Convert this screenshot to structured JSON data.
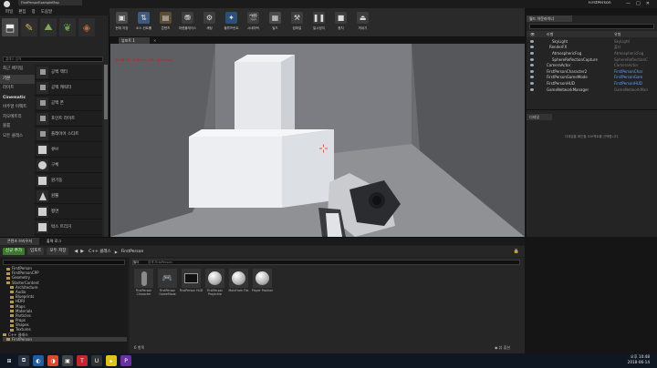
{
  "titlebar": {
    "doc_title": "FirstPersonExampleMap",
    "project": "FirstPerson"
  },
  "menu": {
    "items": [
      "파일",
      "편집",
      "창",
      "도움말"
    ]
  },
  "modes": {
    "search_placeholder": "클래스 검색",
    "categories": [
      {
        "label": "최근 배치됨",
        "selected": false,
        "bold": false
      },
      {
        "label": "기본",
        "selected": true,
        "bold": false
      },
      {
        "label": "라이트",
        "selected": false,
        "bold": false
      },
      {
        "label": "Cinematic",
        "selected": false,
        "bold": true
      },
      {
        "label": "비주얼 이펙트",
        "selected": false,
        "bold": false
      },
      {
        "label": "지오메트리",
        "selected": false,
        "bold": false
      },
      {
        "label": "볼륨",
        "selected": false,
        "bold": false
      },
      {
        "label": "모든 클래스",
        "selected": false,
        "bold": false
      }
    ],
    "items": [
      "공백 액터",
      "공백 캐릭터",
      "공백 폰",
      "포인트 라이트",
      "플레이어 스타트",
      "큐브",
      "구체",
      "원기둥",
      "원뿔",
      "평면",
      "박스 트리거",
      "구체 트리거"
    ]
  },
  "toolbar": {
    "buttons": [
      {
        "label": "현재 저장",
        "icon": "save-icon",
        "color": "#4a4a4a"
      },
      {
        "label": "소스 컨트롤",
        "icon": "source-control-icon",
        "color": "#3f5a7d"
      },
      {
        "label": "콘텐츠",
        "icon": "content-icon",
        "color": "#5c4b35"
      },
      {
        "label": "마켓플레이스",
        "icon": "marketplace-icon",
        "color": "#3d3d3d"
      },
      {
        "label": "세팅",
        "icon": "settings-icon",
        "color": "#3d3d3d"
      },
      {
        "label": "블루프린트",
        "icon": "blueprint-icon",
        "color": "#2d4f7c"
      },
      {
        "label": "시네마틱",
        "icon": "cinematics-icon",
        "color": "#3d3d3d"
      },
      {
        "label": "빌드",
        "icon": "build-icon",
        "color": "#4a4a4a"
      },
      {
        "label": "컴파일",
        "icon": "compile-icon",
        "color": "#3d3d3d"
      },
      {
        "label": "일시정지",
        "icon": "pause-icon",
        "color": "#3d3d3d"
      },
      {
        "label": "중지",
        "icon": "stop-icon",
        "color": "#3d3d3d"
      },
      {
        "label": "꺼내기",
        "icon": "eject-icon",
        "color": "#3d3d3d"
      }
    ]
  },
  "viewport": {
    "tab_label": "뷰포트 1",
    "stats": "38.68 FPS 25.85 ms (MS: 25.85 ms)"
  },
  "outliner": {
    "tab_label": "월드 아웃라이너",
    "col_label": "라벨",
    "col_type": "유형",
    "rows": [
      {
        "name": "SkyLight",
        "type": "SkyLight",
        "indent": 2,
        "selected": false,
        "link": false
      },
      {
        "name": "RenderFX",
        "type": "폴더",
        "indent": 1,
        "selected": false,
        "link": false
      },
      {
        "name": "AtmosphericFog",
        "type": "AtmosphericFog",
        "indent": 2,
        "selected": false,
        "link": false
      },
      {
        "name": "SphereReflectionCapture",
        "type": "SphereReflectionC",
        "indent": 2,
        "selected": false,
        "link": false
      },
      {
        "name": "CameraActor",
        "type": "CameraActor",
        "indent": 0,
        "selected": false,
        "link": false
      },
      {
        "name": "FirstPersonCharacter2",
        "type": "FirstPersonChar",
        "indent": 0,
        "selected": false,
        "link": true
      },
      {
        "name": "FirstPersonGameMode",
        "type": "FirstPersonGam",
        "indent": 0,
        "selected": false,
        "link": true
      },
      {
        "name": "FirstPersonHUD",
        "type": "FirstPersonHUD",
        "indent": 0,
        "selected": false,
        "link": true
      },
      {
        "name": "GameNetworkManager",
        "type": "GameNetworkMan",
        "indent": 0,
        "selected": false,
        "link": false
      }
    ],
    "count": "43 액터",
    "view_options": "◉ 뷰 옵션"
  },
  "details": {
    "tab_label": "디테일",
    "empty_message": "디테일을 확인할 오브젝트를 선택합니다."
  },
  "content_browser": {
    "tabs": [
      "콘텐츠 브라우저",
      "출력 로그"
    ],
    "add_new": "신규 추가",
    "import": "임포트",
    "save_all": "모두 저장",
    "path": "C++ 클래스",
    "path_leaf": "FirstPerson",
    "filter_label": "필터",
    "search_placeholder": "검색 FirstPerson",
    "tree": [
      {
        "label": "FirstPerson",
        "indent": 1
      },
      {
        "label": "FirstPersonCPP",
        "indent": 1
      },
      {
        "label": "Geometry",
        "indent": 1
      },
      {
        "label": "StarterContent",
        "indent": 1
      },
      {
        "label": "Architecture",
        "indent": 2
      },
      {
        "label": "Audio",
        "indent": 2
      },
      {
        "label": "Blueprints",
        "indent": 2
      },
      {
        "label": "HDRI",
        "indent": 2
      },
      {
        "label": "Maps",
        "indent": 2
      },
      {
        "label": "Materials",
        "indent": 2
      },
      {
        "label": "Particles",
        "indent": 2
      },
      {
        "label": "Props",
        "indent": 2
      },
      {
        "label": "Shapes",
        "indent": 2
      },
      {
        "label": "Textures",
        "indent": 2
      },
      {
        "label": "C++ 클래스",
        "indent": 0
      },
      {
        "label": "FirstPerson",
        "indent": 1,
        "selected": true
      }
    ],
    "assets": [
      {
        "label": "FirstPerson Character",
        "icon": "character-icon"
      },
      {
        "label": "FirstPerson GameMode",
        "icon": "gamemode-icon"
      },
      {
        "label": "FirstPerson HUD",
        "icon": "hud-icon"
      },
      {
        "label": "FirstPerson Projectile",
        "icon": "sphere-icon"
      },
      {
        "label": "MainFram File",
        "icon": "sphere-icon"
      },
      {
        "label": "Player Position",
        "icon": "sphere-icon"
      }
    ],
    "count": "6 항목",
    "view_options": "◉ 뷰 옵션"
  },
  "taskbar": {
    "apps": [
      {
        "label": "⊞",
        "color": "#0f1722"
      },
      {
        "label": "⧉",
        "color": "#2a3444"
      },
      {
        "label": "◐",
        "color": "#1f5f9f"
      },
      {
        "label": "◑",
        "color": "#d9492e"
      },
      {
        "label": "▣",
        "color": "#444444"
      },
      {
        "label": "T",
        "color": "#c0282e"
      },
      {
        "label": "U",
        "color": "#333333"
      },
      {
        "label": "▸",
        "color": "#e0c21e"
      },
      {
        "label": "P",
        "color": "#6a2fa0"
      }
    ],
    "time": "오후 10:48",
    "date": "2018-06-14"
  }
}
